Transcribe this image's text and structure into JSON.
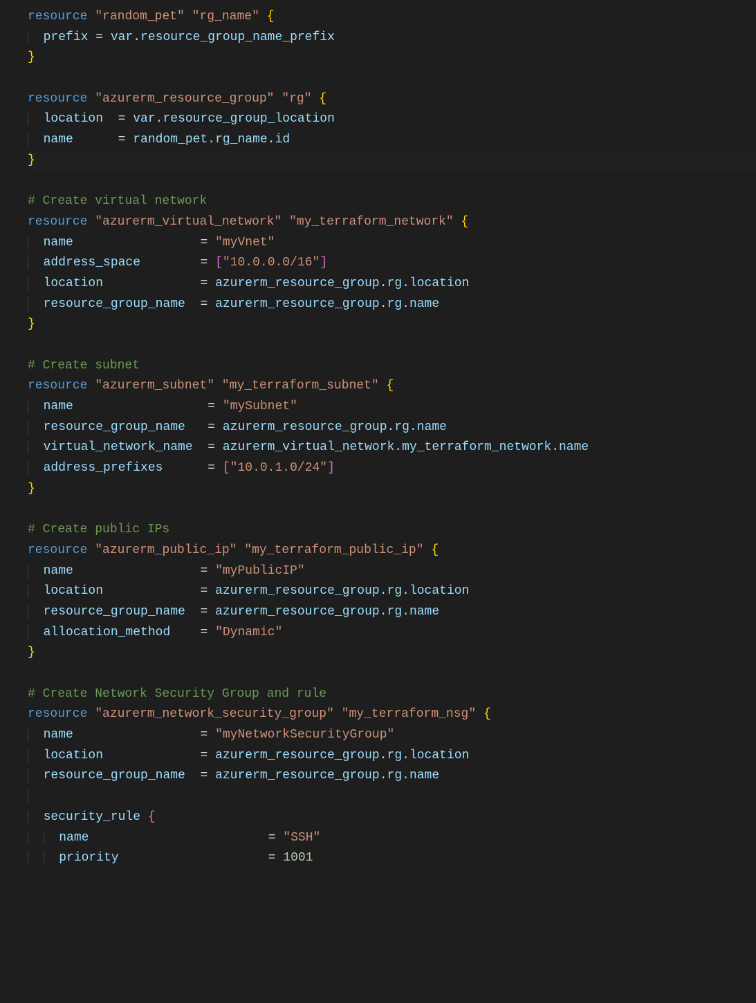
{
  "code": {
    "lines": [
      {
        "t": "res_open",
        "kw": "resource",
        "s1": "\"random_pet\"",
        "s2": "\"rg_name\"",
        "brace": "{"
      },
      {
        "t": "assign",
        "indent": 1,
        "lhs": "prefix",
        "eq": "=",
        "rhs_parts": [
          {
            "c": "ident",
            "v": "var"
          },
          {
            "c": "op",
            "v": "."
          },
          {
            "c": "ident",
            "v": "resource_group_name_prefix"
          }
        ]
      },
      {
        "t": "brace_close",
        "brace": "}",
        "color": "y"
      },
      {
        "t": "blank"
      },
      {
        "t": "res_open",
        "kw": "resource",
        "s1": "\"azurerm_resource_group\"",
        "s2": "\"rg\"",
        "brace": "{"
      },
      {
        "t": "assign",
        "indent": 1,
        "lhs": "location",
        "eq": "=",
        "rhs_parts": [
          {
            "c": "ident",
            "v": "var"
          },
          {
            "c": "op",
            "v": "."
          },
          {
            "c": "ident",
            "v": "resource_group_location"
          }
        ],
        "pad": " "
      },
      {
        "t": "assign",
        "indent": 1,
        "lhs": "name",
        "eq": "=",
        "rhs_parts": [
          {
            "c": "ident",
            "v": "random_pet"
          },
          {
            "c": "op",
            "v": "."
          },
          {
            "c": "ident",
            "v": "rg_name"
          },
          {
            "c": "op",
            "v": "."
          },
          {
            "c": "ident",
            "v": "id"
          }
        ],
        "pad": "     "
      },
      {
        "t": "brace_close",
        "brace": "}",
        "color": "y",
        "hl": true
      },
      {
        "t": "blank"
      },
      {
        "t": "comment",
        "v": "# Create virtual network"
      },
      {
        "t": "res_open",
        "kw": "resource",
        "s1": "\"azurerm_virtual_network\"",
        "s2": "\"my_terraform_network\"",
        "brace": "{"
      },
      {
        "t": "assign",
        "indent": 1,
        "lhs": "name",
        "pad": "                ",
        "eq": "=",
        "rhs_parts": [
          {
            "c": "string",
            "v": "\"myVnet\""
          }
        ]
      },
      {
        "t": "assign",
        "indent": 1,
        "lhs": "address_space",
        "pad": "       ",
        "eq": "=",
        "rhs_parts": [
          {
            "c": "brace-p",
            "v": "["
          },
          {
            "c": "string",
            "v": "\"10.0.0.0/16\""
          },
          {
            "c": "brace-p",
            "v": "]"
          }
        ]
      },
      {
        "t": "assign",
        "indent": 1,
        "lhs": "location",
        "pad": "            ",
        "eq": "=",
        "rhs_parts": [
          {
            "c": "ident",
            "v": "azurerm_resource_group"
          },
          {
            "c": "op",
            "v": "."
          },
          {
            "c": "ident",
            "v": "rg"
          },
          {
            "c": "op",
            "v": "."
          },
          {
            "c": "ident",
            "v": "location"
          }
        ]
      },
      {
        "t": "assign",
        "indent": 1,
        "lhs": "resource_group_name",
        "pad": " ",
        "eq": "=",
        "rhs_parts": [
          {
            "c": "ident",
            "v": "azurerm_resource_group"
          },
          {
            "c": "op",
            "v": "."
          },
          {
            "c": "ident",
            "v": "rg"
          },
          {
            "c": "op",
            "v": "."
          },
          {
            "c": "ident",
            "v": "name"
          }
        ]
      },
      {
        "t": "brace_close",
        "brace": "}",
        "color": "y"
      },
      {
        "t": "blank"
      },
      {
        "t": "comment",
        "v": "# Create subnet"
      },
      {
        "t": "res_open",
        "kw": "resource",
        "s1": "\"azurerm_subnet\"",
        "s2": "\"my_terraform_subnet\"",
        "brace": "{"
      },
      {
        "t": "assign",
        "indent": 1,
        "lhs": "name",
        "pad": "                 ",
        "eq": "=",
        "rhs_parts": [
          {
            "c": "string",
            "v": "\"mySubnet\""
          }
        ]
      },
      {
        "t": "assign",
        "indent": 1,
        "lhs": "resource_group_name",
        "pad": "  ",
        "eq": "=",
        "rhs_parts": [
          {
            "c": "ident",
            "v": "azurerm_resource_group"
          },
          {
            "c": "op",
            "v": "."
          },
          {
            "c": "ident",
            "v": "rg"
          },
          {
            "c": "op",
            "v": "."
          },
          {
            "c": "ident",
            "v": "name"
          }
        ]
      },
      {
        "t": "assign",
        "indent": 1,
        "lhs": "virtual_network_name",
        "pad": " ",
        "eq": "=",
        "rhs_parts": [
          {
            "c": "ident",
            "v": "azurerm_virtual_network"
          },
          {
            "c": "op",
            "v": "."
          },
          {
            "c": "ident",
            "v": "my_terraform_network"
          },
          {
            "c": "op",
            "v": "."
          },
          {
            "c": "ident",
            "v": "name"
          }
        ]
      },
      {
        "t": "assign",
        "indent": 1,
        "lhs": "address_prefixes",
        "pad": "     ",
        "eq": "=",
        "rhs_parts": [
          {
            "c": "brace-p",
            "v": "["
          },
          {
            "c": "string",
            "v": "\"10.0.1.0/24\""
          },
          {
            "c": "brace-p",
            "v": "]"
          }
        ]
      },
      {
        "t": "brace_close",
        "brace": "}",
        "color": "y"
      },
      {
        "t": "blank"
      },
      {
        "t": "comment",
        "v": "# Create public IPs"
      },
      {
        "t": "res_open",
        "kw": "resource",
        "s1": "\"azurerm_public_ip\"",
        "s2": "\"my_terraform_public_ip\"",
        "brace": "{"
      },
      {
        "t": "assign",
        "indent": 1,
        "lhs": "name",
        "pad": "                ",
        "eq": "=",
        "rhs_parts": [
          {
            "c": "string",
            "v": "\"myPublicIP\""
          }
        ]
      },
      {
        "t": "assign",
        "indent": 1,
        "lhs": "location",
        "pad": "            ",
        "eq": "=",
        "rhs_parts": [
          {
            "c": "ident",
            "v": "azurerm_resource_group"
          },
          {
            "c": "op",
            "v": "."
          },
          {
            "c": "ident",
            "v": "rg"
          },
          {
            "c": "op",
            "v": "."
          },
          {
            "c": "ident",
            "v": "location"
          }
        ]
      },
      {
        "t": "assign",
        "indent": 1,
        "lhs": "resource_group_name",
        "pad": " ",
        "eq": "=",
        "rhs_parts": [
          {
            "c": "ident",
            "v": "azurerm_resource_group"
          },
          {
            "c": "op",
            "v": "."
          },
          {
            "c": "ident",
            "v": "rg"
          },
          {
            "c": "op",
            "v": "."
          },
          {
            "c": "ident",
            "v": "name"
          }
        ]
      },
      {
        "t": "assign",
        "indent": 1,
        "lhs": "allocation_method",
        "pad": "   ",
        "eq": "=",
        "rhs_parts": [
          {
            "c": "string",
            "v": "\"Dynamic\""
          }
        ]
      },
      {
        "t": "brace_close",
        "brace": "}",
        "color": "y"
      },
      {
        "t": "blank"
      },
      {
        "t": "comment",
        "v": "# Create Network Security Group and rule"
      },
      {
        "t": "res_open",
        "kw": "resource",
        "s1": "\"azurerm_network_security_group\"",
        "s2": "\"my_terraform_nsg\"",
        "brace": "{"
      },
      {
        "t": "assign",
        "indent": 1,
        "lhs": "name",
        "pad": "                ",
        "eq": "=",
        "rhs_parts": [
          {
            "c": "string",
            "v": "\"myNetworkSecurityGroup\""
          }
        ]
      },
      {
        "t": "assign",
        "indent": 1,
        "lhs": "location",
        "pad": "            ",
        "eq": "=",
        "rhs_parts": [
          {
            "c": "ident",
            "v": "azurerm_resource_group"
          },
          {
            "c": "op",
            "v": "."
          },
          {
            "c": "ident",
            "v": "rg"
          },
          {
            "c": "op",
            "v": "."
          },
          {
            "c": "ident",
            "v": "location"
          }
        ]
      },
      {
        "t": "assign",
        "indent": 1,
        "lhs": "resource_group_name",
        "pad": " ",
        "eq": "=",
        "rhs_parts": [
          {
            "c": "ident",
            "v": "azurerm_resource_group"
          },
          {
            "c": "op",
            "v": "."
          },
          {
            "c": "ident",
            "v": "rg"
          },
          {
            "c": "op",
            "v": "."
          },
          {
            "c": "ident",
            "v": "name"
          }
        ]
      },
      {
        "t": "blank_indent",
        "indent": 1
      },
      {
        "t": "block_open",
        "indent": 1,
        "lhs": "security_rule",
        "brace": "{",
        "bcolor": "p"
      },
      {
        "t": "assign",
        "indent": 2,
        "lhs": "name",
        "pad": "                       ",
        "eq": "=",
        "rhs_parts": [
          {
            "c": "string",
            "v": "\"SSH\""
          }
        ]
      },
      {
        "t": "assign",
        "indent": 2,
        "lhs": "priority",
        "pad": "                   ",
        "eq": "=",
        "rhs_parts": [
          {
            "c": "num",
            "v": "1001"
          }
        ]
      }
    ]
  }
}
